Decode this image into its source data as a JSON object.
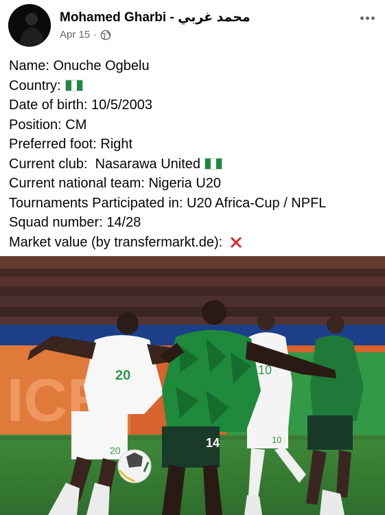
{
  "post": {
    "author": "Mohamed Gharbi - محمد غربي",
    "date": "Apr 15",
    "separator": "·",
    "privacy_icon": "globe-icon",
    "more_icon": "more-horizontal-icon"
  },
  "body": {
    "lines": [
      "Name: Onuche Ogbelu",
      "Country:",
      "Date of birth: 10/5/2003",
      "Position: CM",
      "Preferred foot: Right",
      "Current club:  Nasarawa United",
      "Current national team: Nigeria U20",
      "Tournaments Participated in: U20 Africa-Cup / NPFL",
      "Squad number: 14/28",
      "Market value (by transfermarkt.de):"
    ],
    "flag_icon": "nigeria-flag-icon",
    "cross_icon": "red-cross-icon"
  },
  "photo": {
    "jersey_left": "20",
    "jersey_center": "14",
    "jersey_right_back": "10",
    "jersey_right_short": "10"
  },
  "colors": {
    "text": "#050505",
    "meta": "#65676b",
    "nigeria_green": "#1a8a3c",
    "cross_red": "#e0232b"
  }
}
